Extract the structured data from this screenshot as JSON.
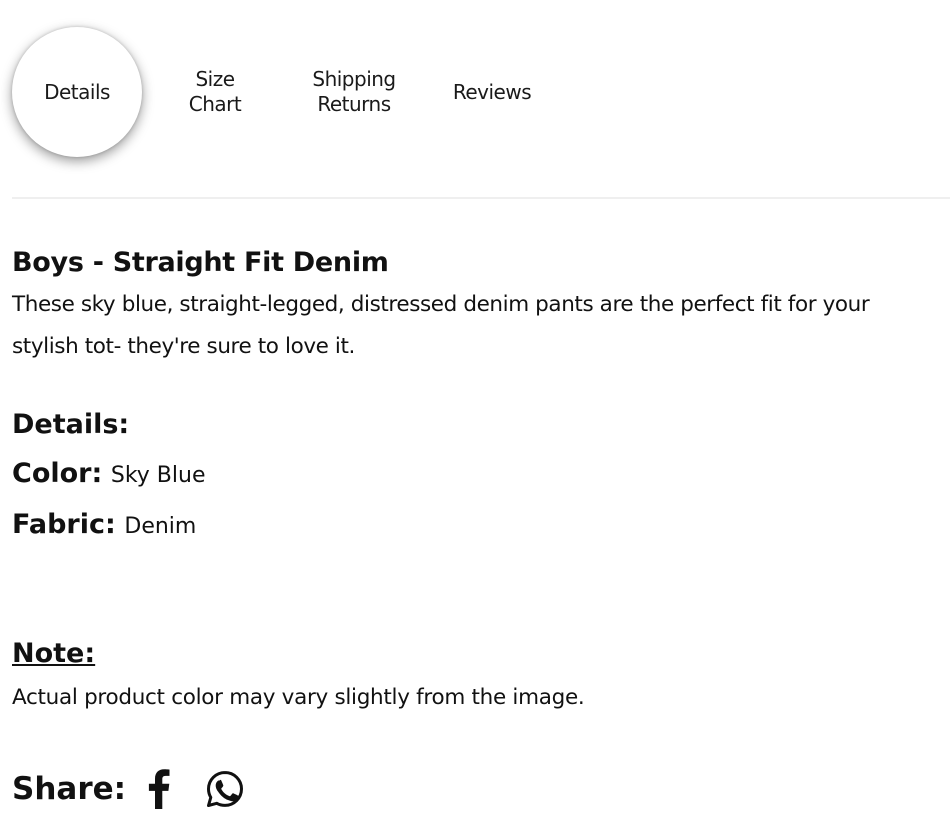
{
  "tabs": [
    {
      "line1": "Details",
      "line2": ""
    },
    {
      "line1": "Size",
      "line2": "Chart"
    },
    {
      "line1": "Shipping",
      "line2": "Returns"
    },
    {
      "line1": "Reviews",
      "line2": ""
    }
  ],
  "product": {
    "title": "Boys - Straight Fit Denim",
    "description": "These sky blue, straight-legged, distressed denim pants are the perfect fit for your stylish tot- they're sure to love it."
  },
  "details": {
    "heading": "Details:",
    "color_label": "Color:",
    "color_value": "Sky Blue",
    "fabric_label": "Fabric:",
    "fabric_value": "Denim"
  },
  "note": {
    "heading": "Note:",
    "text": "Actual product color may vary slightly from the image."
  },
  "share": {
    "label": "Share:",
    "icons": [
      "facebook-icon",
      "whatsapp-icon"
    ]
  }
}
